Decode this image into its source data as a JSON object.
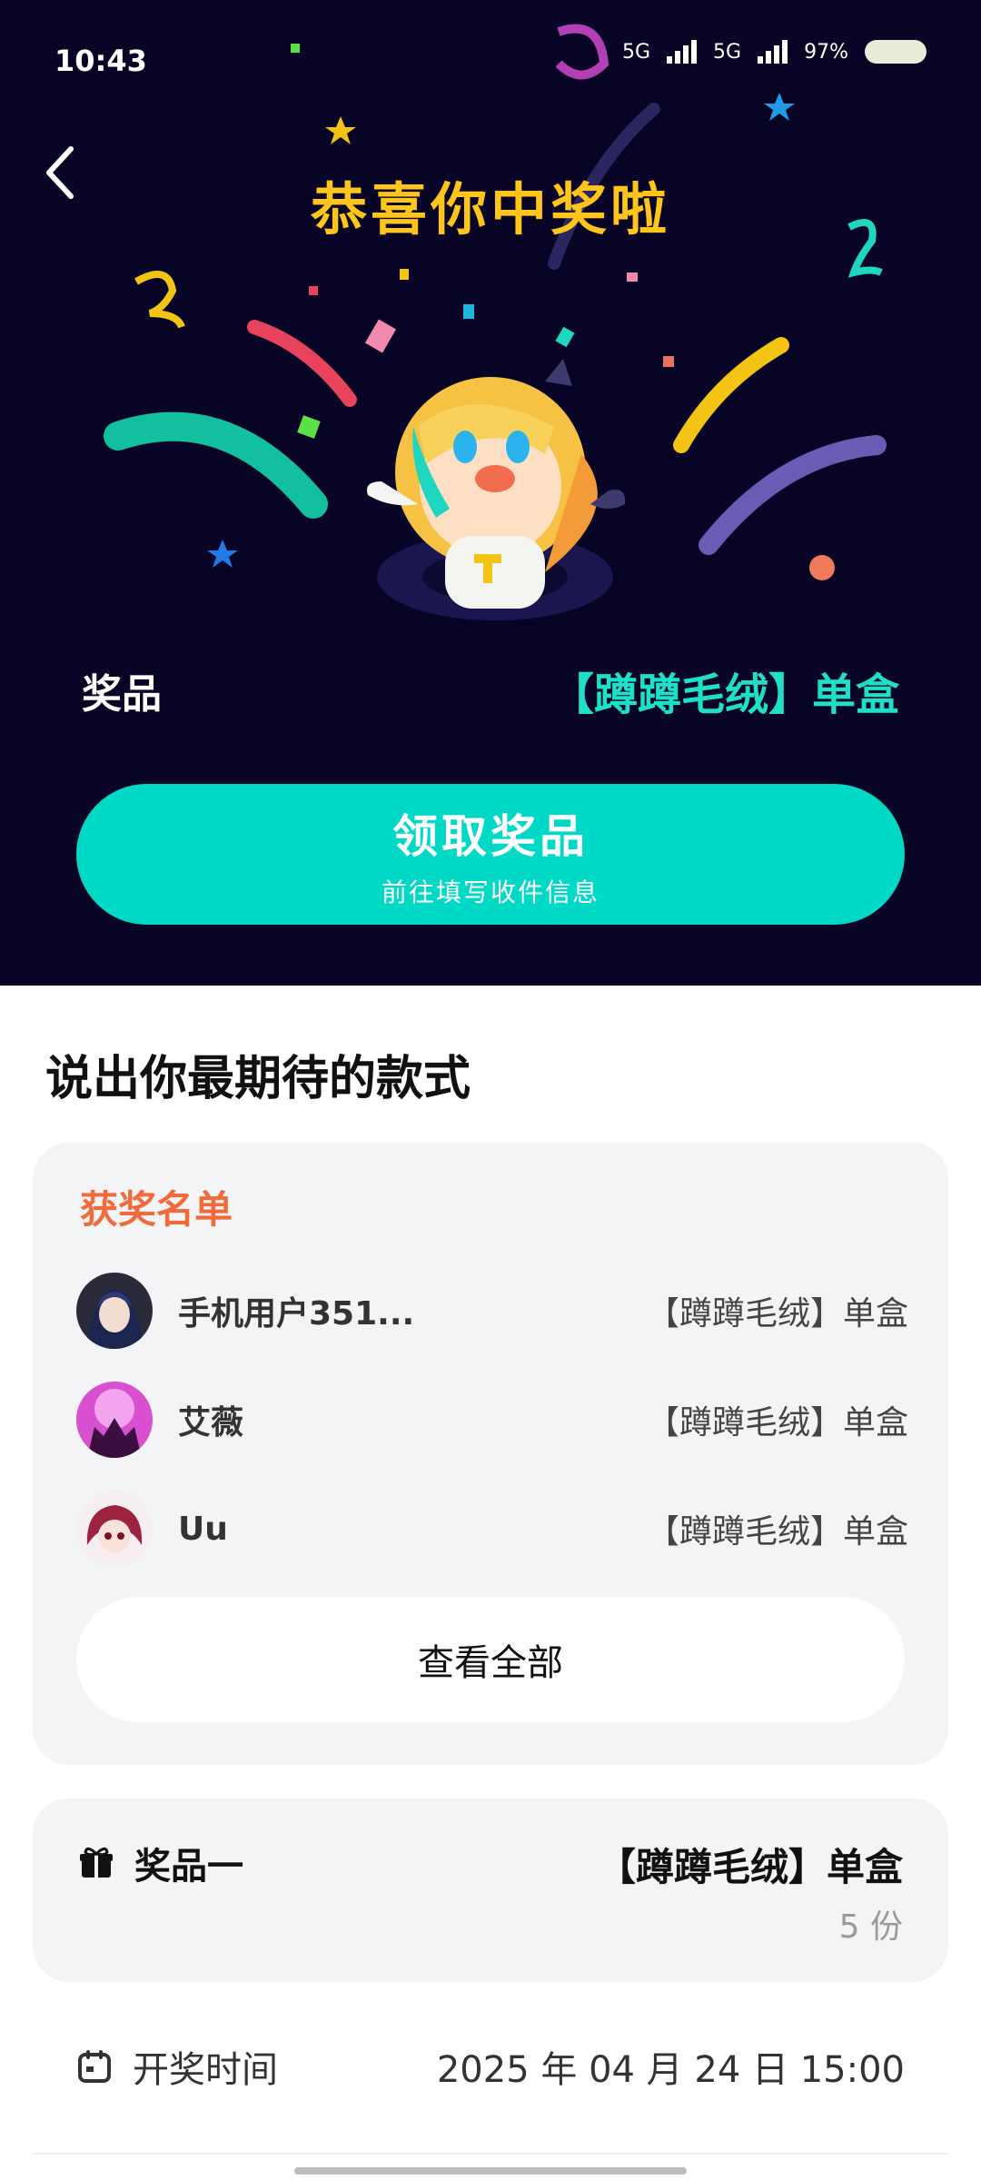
{
  "status_bar": {
    "time": "10:43",
    "battery": "97%",
    "network_labels": [
      "5G",
      "5G"
    ]
  },
  "hero": {
    "title": "恭喜你中奖啦",
    "prize_label": "奖品",
    "prize_value": "【蹲蹲毛绒】单盒",
    "claim_button": {
      "label": "领取奖品",
      "sublabel": "前往填写收件信息"
    }
  },
  "section": {
    "title": "说出你最期待的款式"
  },
  "winners": {
    "heading": "获奖名单",
    "rows": [
      {
        "name": "手机用户351...",
        "prize": "【蹲蹲毛绒】单盒"
      },
      {
        "name": "艾薇",
        "prize": "【蹲蹲毛绒】单盒"
      },
      {
        "name": "Uu",
        "prize": "【蹲蹲毛绒】单盒"
      }
    ],
    "view_all": "查看全部"
  },
  "prize_card": {
    "label": "奖品一",
    "value": "【蹲蹲毛绒】单盒",
    "count": "5 份"
  },
  "draw_time": {
    "label": "开奖时间",
    "value": "2025 年 04 月 24 日 15:00"
  },
  "colors": {
    "hero_bg": "#070426",
    "title_yellow": "#ffc51a",
    "accent_teal": "#00d9c6",
    "winners_orange": "#f26a3c"
  }
}
